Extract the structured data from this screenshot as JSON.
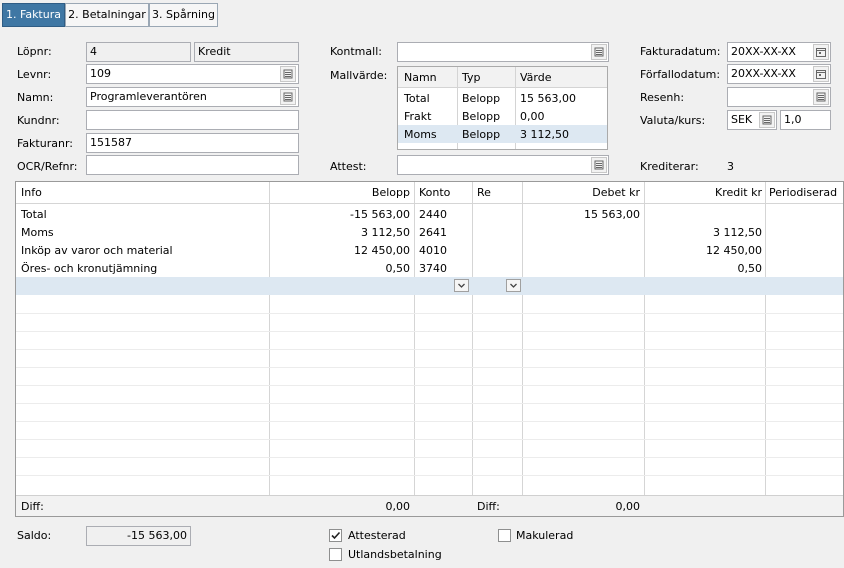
{
  "tabs": [
    {
      "label": "1. Faktura"
    },
    {
      "label": "2. Betalningar"
    },
    {
      "label": "3. Spårning"
    }
  ],
  "left": {
    "lopnr_label": "Löpnr:",
    "lopnr_value": "4",
    "lopnr_type": "Kredit",
    "levnr_label": "Levnr:",
    "levnr_value": "109",
    "namn_label": "Namn:",
    "namn_value": "Programleverantören",
    "kundnr_label": "Kundnr:",
    "kundnr_value": "",
    "fakturanr_label": "Fakturanr:",
    "fakturanr_value": "151587",
    "ocr_label": "OCR/Refnr:",
    "ocr_value": ""
  },
  "middle": {
    "kontmall_label": "Kontmall:",
    "kontmall_value": "",
    "mallvarde_label": "Mallvärde:",
    "mallvarde_columns": [
      "Namn",
      "Typ",
      "Värde"
    ],
    "mallvarde_rows": [
      [
        "Total",
        "Belopp",
        "15 563,00"
      ],
      [
        "Frakt",
        "Belopp",
        "0,00"
      ],
      [
        "Moms",
        "Belopp",
        "3 112,50"
      ]
    ],
    "attest_label": "Attest:",
    "attest_value": ""
  },
  "right": {
    "fakturadatum_label": "Fakturadatum:",
    "fakturadatum_value": "20XX-XX-XX",
    "forfallodatum_label": "Förfallodatum:",
    "forfallodatum_value": "20XX-XX-XX",
    "resenh_label": "Resenh:",
    "resenh_value": "",
    "valuta_label": "Valuta/kurs:",
    "valuta_value": "SEK",
    "kurs_value": "1,0",
    "krediterar_label": "Krediterar:",
    "krediterar_value": "3"
  },
  "grid": {
    "columns": [
      "Info",
      "Belopp",
      "Konto",
      "Re",
      "Debet kr",
      "Kredit kr",
      "Periodiserad"
    ],
    "rows": [
      [
        "Total",
        "-15 563,00",
        "2440",
        "",
        "15 563,00",
        "",
        ""
      ],
      [
        "Moms",
        "3 112,50",
        "2641",
        "",
        "",
        "3 112,50",
        ""
      ],
      [
        "Inköp av varor och material",
        "12 450,00",
        "4010",
        "",
        "",
        "12 450,00",
        ""
      ],
      [
        "Öres- och kronutjämning",
        "0,50",
        "3740",
        "",
        "",
        "0,50",
        ""
      ]
    ],
    "footer": {
      "diff1_label": "Diff:",
      "diff1_value": "0,00",
      "diff2_label": "Diff:",
      "diff2_value": "0,00"
    }
  },
  "bottom": {
    "saldo_label": "Saldo:",
    "saldo_value": "-15 563,00",
    "attesterad_label": "Attesterad",
    "attesterad_checked": true,
    "utlandsbetalning_label": "Utlandsbetalning",
    "utlandsbetalning_checked": false,
    "makulerad_label": "Makulerad",
    "makulerad_checked": false
  },
  "icons": {
    "picker": "list-picker-icon",
    "calendar": "calendar-icon",
    "dropdown": "chevron-down-icon",
    "check": "checkmark-icon"
  },
  "colors": {
    "active_tab": "#3f77a4",
    "selected_row": "#dde8f2",
    "new_row": "#dde8f2"
  }
}
